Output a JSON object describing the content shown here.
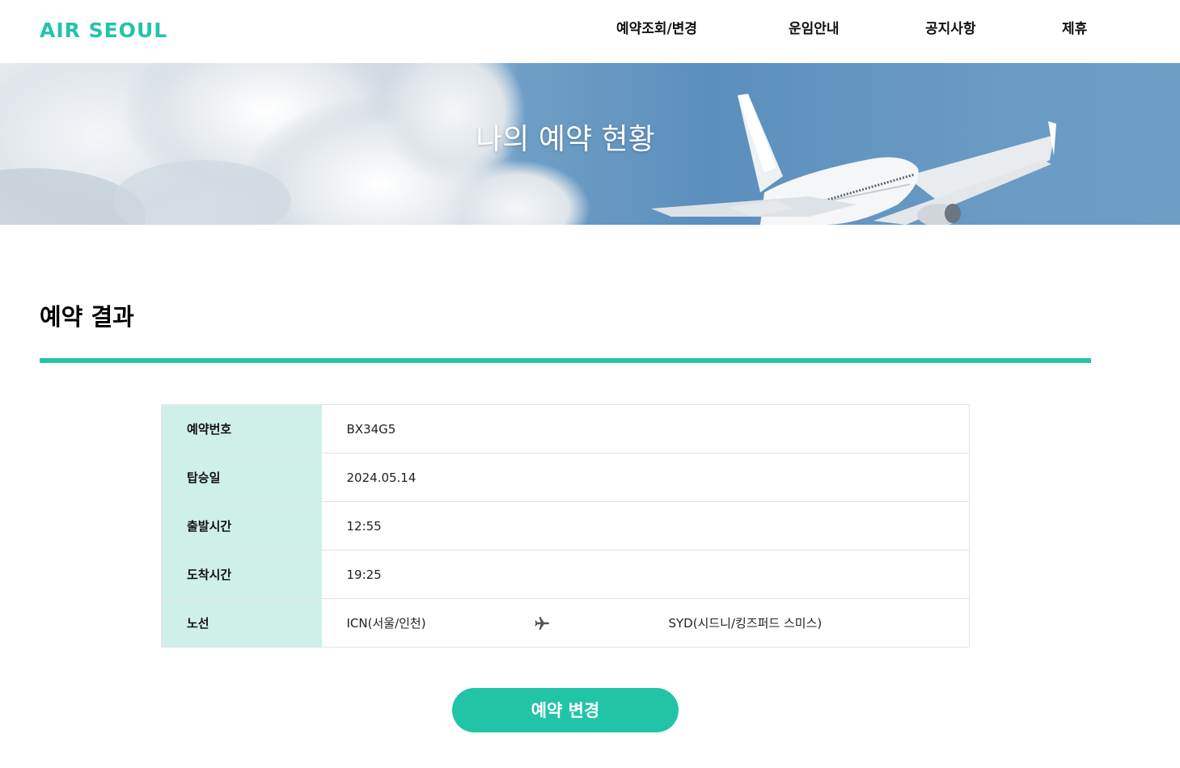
{
  "colors": {
    "brand": "#22c4a8",
    "label_bg": "#cff0e8",
    "sky": "#5b8fbd"
  },
  "header": {
    "logo": "AIR SEOUL",
    "nav": [
      {
        "label": "예약조회/변경"
      },
      {
        "label": "운임안내"
      },
      {
        "label": "공지사항"
      },
      {
        "label": "제휴"
      }
    ]
  },
  "hero": {
    "title": "나의 예약 현황"
  },
  "section": {
    "title": "예약 결과"
  },
  "result": {
    "rows": [
      {
        "label": "예약번호",
        "value": "BX34G5"
      },
      {
        "label": "탑승일",
        "value": "2024.05.14"
      },
      {
        "label": "출발시간",
        "value": "12:55"
      },
      {
        "label": "도착시간",
        "value": "19:25"
      }
    ],
    "route": {
      "label": "노선",
      "from": "ICN(서울/인천)",
      "icon": "airplane-icon",
      "to": "SYD(시드니/킹즈퍼드 스미스)"
    }
  },
  "actions": {
    "change_label": "예약 변경"
  }
}
